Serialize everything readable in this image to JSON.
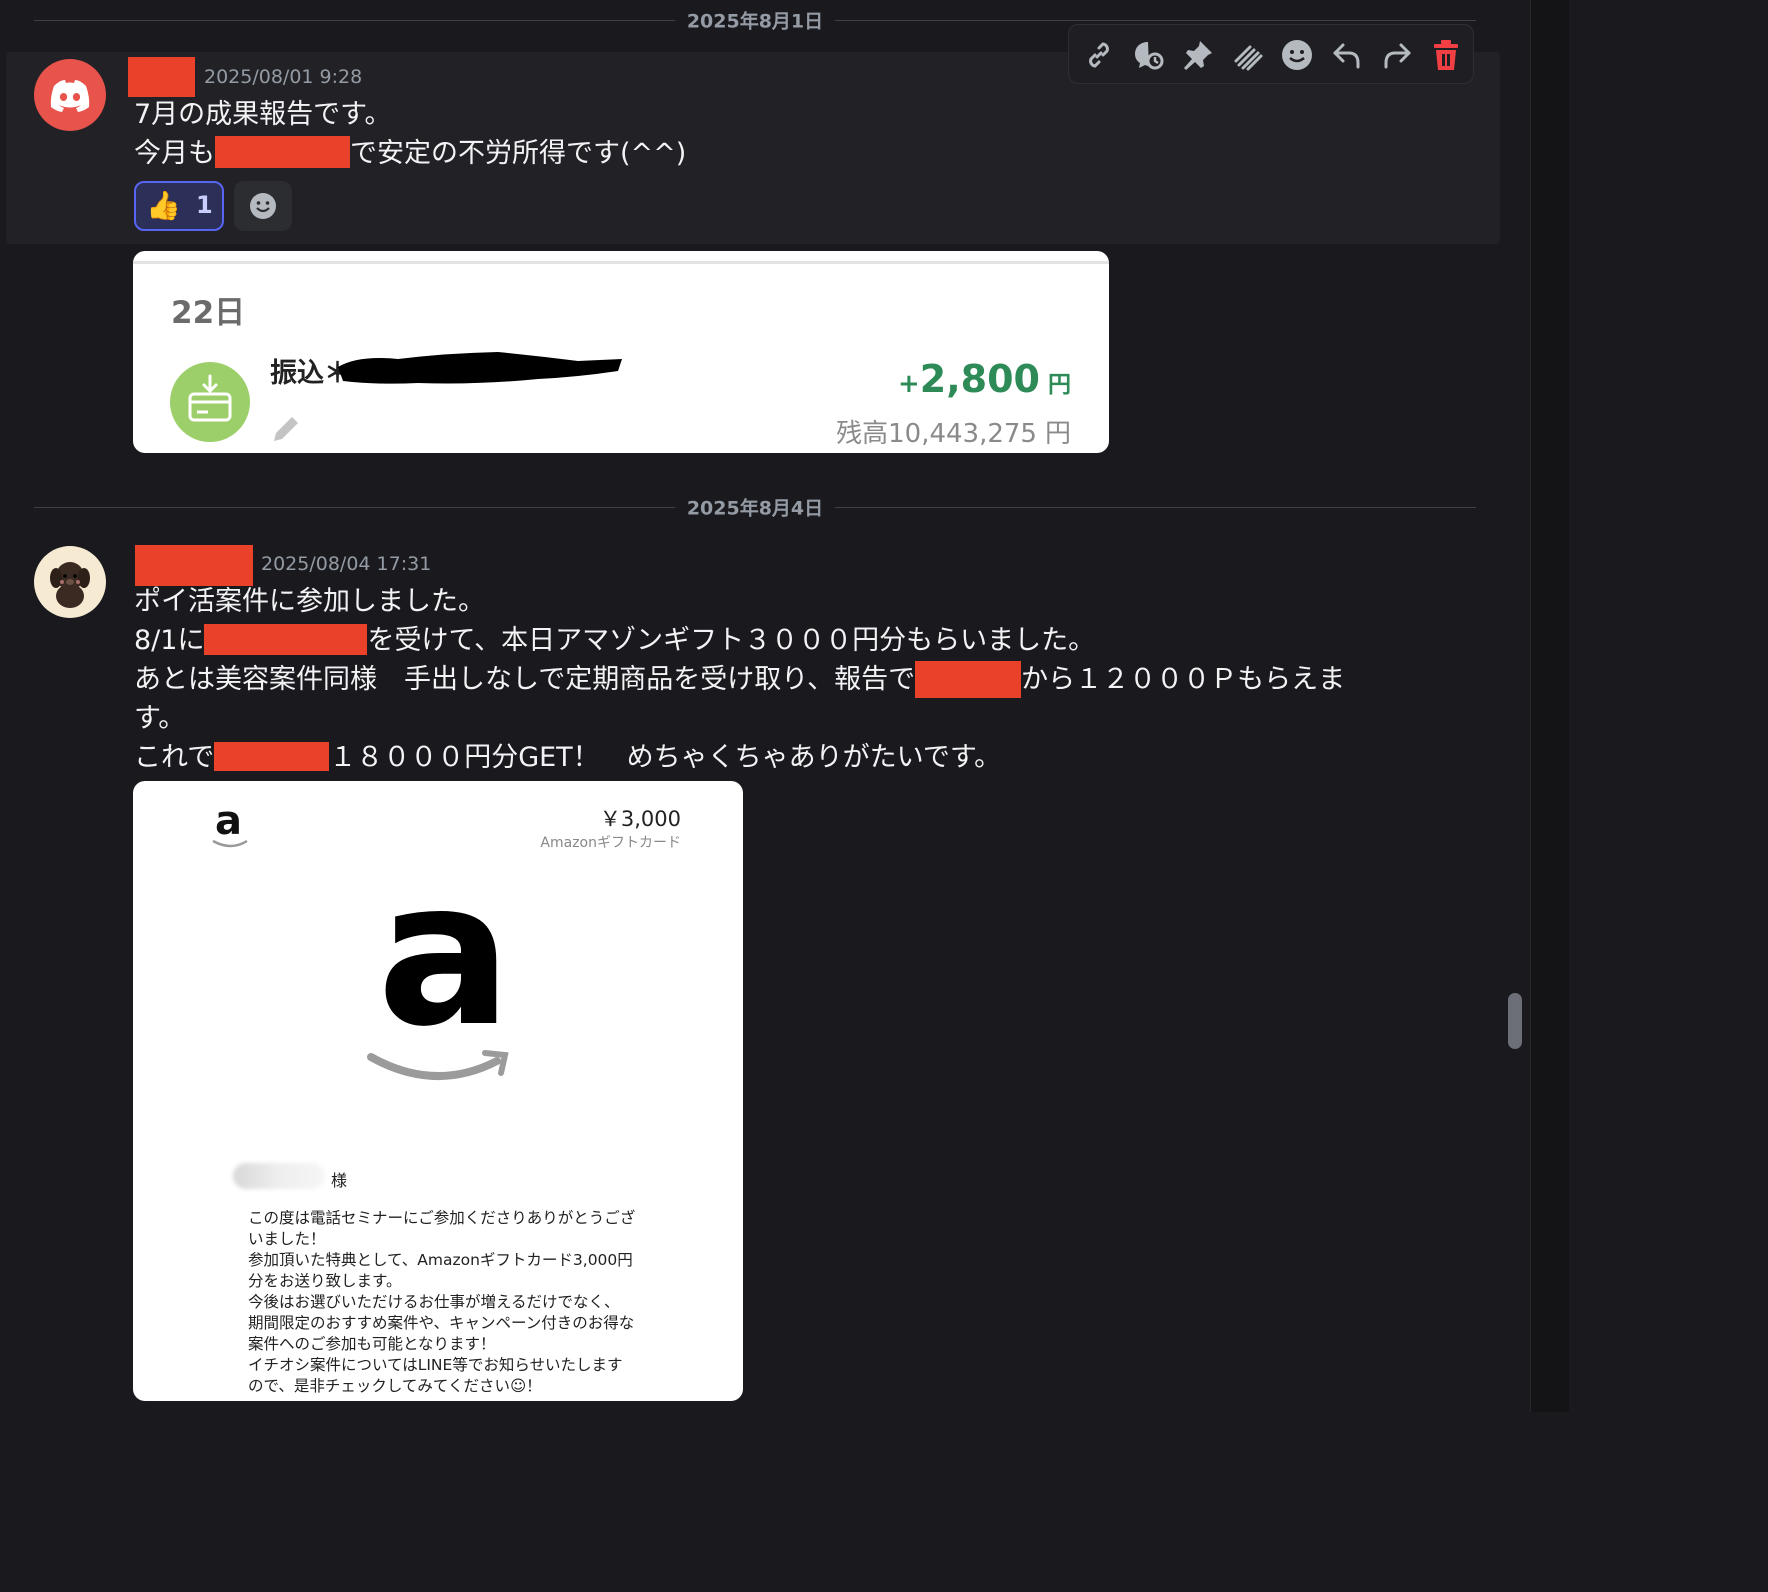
{
  "dividers": {
    "first": "2025年8月1日",
    "second": "2025年8月4日"
  },
  "message1": {
    "timestamp": "2025/08/01 9:28",
    "line1": "7月の成果報告です。",
    "line2_before": "今月も",
    "line2_after": "で安定の不労所得です(^^)",
    "reaction_emoji": "👍",
    "reaction_count": "1"
  },
  "bank_card": {
    "day": "22日",
    "label": "振込＊",
    "amount_sign": "+",
    "amount": "2,800",
    "amount_unit": "円",
    "balance_label": "残高",
    "balance": "10,443,275",
    "balance_unit": "円"
  },
  "message2": {
    "timestamp": "2025/08/04 17:31",
    "line1": "ポイ活案件に参加しました。",
    "line2_before": "8/1に",
    "line2_after": "を受けて、本日アマゾンギフト３０００円分もらいました。",
    "line3_before": "あとは美容案件同様　手出しなしで定期商品を受け取り、報告で",
    "line3_after": "から１２０００Ｐもらえま",
    "line4": "す。",
    "line5_before": "これで",
    "line5_after": "１８０００円分GET！　めちゃくちゃありがたいです。"
  },
  "amazon_card": {
    "logo_letter": "a",
    "price": "￥3,000",
    "card_type": "Amazonギフトカード",
    "big_logo_letter": "a",
    "recipient_suffix": "様",
    "body_lines": [
      "この度は電話セミナーにご参加くださりありがとうござ",
      "いました！",
      "参加頂いた特典として、Amazonギフトカード3,000円",
      "分をお送り致します。",
      "今後はお選びいただけるお仕事が増えるだけでなく、",
      "期間限定のおすすめ案件や、キャンペーン付きのお得な",
      "案件へのご参加も可能となります！",
      "イチオシ案件についてはLINE等でお知らせいたします",
      "ので、是非チェックしてみてください☺！"
    ]
  },
  "toolbar_icons": [
    "link-icon",
    "thread-icon",
    "pin-icon",
    "forum-icon",
    "emoji-icon",
    "reply-icon",
    "forward-icon",
    "trash-icon"
  ],
  "colors": {
    "background": "#1a1a1e",
    "redaction": "#e9412a",
    "discord_red": "#e8534b",
    "reaction_border": "#5865f2",
    "positive_amount": "#2e8b57",
    "delete_red": "#f23f43",
    "bank_icon_green": "#9ccf6a"
  }
}
